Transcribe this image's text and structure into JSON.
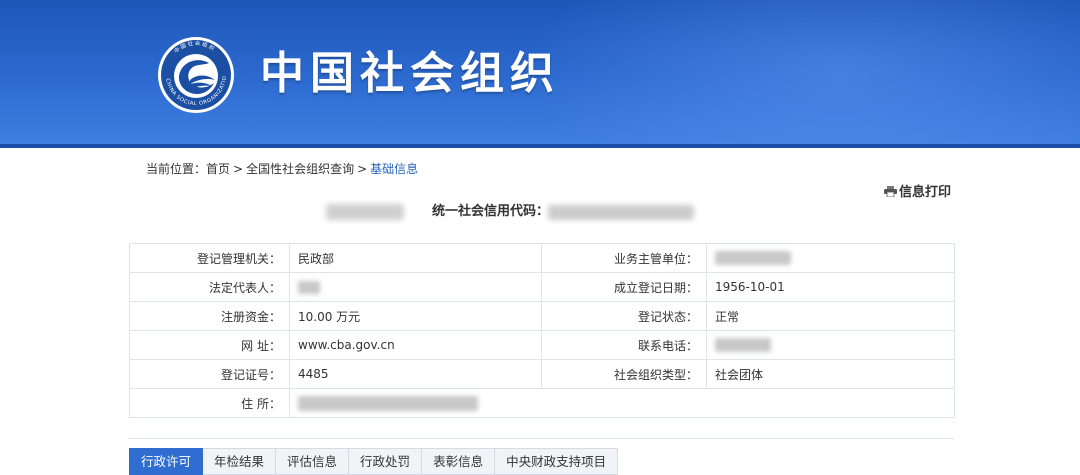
{
  "header": {
    "site_title": "中国社会组织",
    "logo_ring_text": "CHINA SOCIAL ORGANIZATION",
    "logo_top_text": "中国社会组织"
  },
  "breadcrumb": {
    "prefix": "当前位置：",
    "items": [
      "首页",
      "全国性社会组织查询",
      "基础信息"
    ],
    "separator": ">"
  },
  "print": {
    "label": "信息打印",
    "icon": "printer-icon"
  },
  "org": {
    "credit_code_label": "统一社会信用代码："
  },
  "info_table": {
    "rows": [
      {
        "left_label": "登记管理机关：",
        "left_value": "民政部",
        "right_label": "业务主管单位：",
        "right_value": ""
      },
      {
        "left_label": "法定代表人：",
        "left_value": "",
        "right_label": "成立登记日期：",
        "right_value": "1956-10-01"
      },
      {
        "left_label": "注册资金：",
        "left_value": "10.00 万元",
        "right_label": "登记状态：",
        "right_value": "正常"
      },
      {
        "left_label": "网 址：",
        "left_value": "www.cba.gov.cn",
        "right_label": "联系电话：",
        "right_value": ""
      },
      {
        "left_label": "登记证号：",
        "left_value": "4485",
        "right_label": "社会组织类型：",
        "right_value": "社会团体"
      }
    ],
    "address_label": "住 所："
  },
  "tabs": [
    {
      "label": "行政许可",
      "active": true
    },
    {
      "label": "年检结果",
      "active": false
    },
    {
      "label": "评估信息",
      "active": false
    },
    {
      "label": "行政处罚",
      "active": false
    },
    {
      "label": "表彰信息",
      "active": false
    },
    {
      "label": "中央财政支持项目",
      "active": false
    }
  ],
  "colors": {
    "banner_blue": "#2c6ad0",
    "active_tab": "#2f6ed0",
    "link_blue": "#2a63b8",
    "table_border": "#dfe3ea"
  }
}
